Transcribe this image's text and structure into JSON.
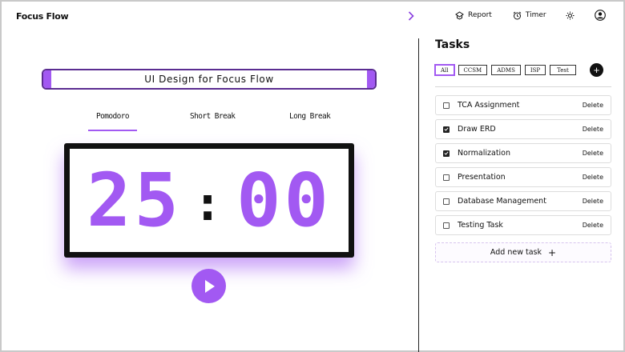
{
  "app": {
    "title": "Focus Flow"
  },
  "nav": {
    "report_label": "Report",
    "timer_label": "Timer"
  },
  "current_task": {
    "value": "UI Design for Focus Flow"
  },
  "modes": [
    {
      "label": "Pomodoro",
      "active": true
    },
    {
      "label": "Short Break",
      "active": false
    },
    {
      "label": "Long Break",
      "active": false
    }
  ],
  "timer": {
    "minutes": "25",
    "separator": ":",
    "seconds": "00"
  },
  "tasks_panel": {
    "heading": "Tasks",
    "filters": [
      {
        "label": "All",
        "active": true
      },
      {
        "label": "CCSM",
        "active": false
      },
      {
        "label": "ADMS",
        "active": false
      },
      {
        "label": "ISP",
        "active": false
      },
      {
        "label": "Test",
        "active": false
      }
    ],
    "add_category_icon": "plus-icon",
    "items": [
      {
        "name": "TCA Assignment",
        "done": false,
        "delete_label": "Delete"
      },
      {
        "name": "Draw ERD",
        "done": true,
        "delete_label": "Delete"
      },
      {
        "name": "Normalization",
        "done": true,
        "delete_label": "Delete"
      },
      {
        "name": "Presentation",
        "done": false,
        "delete_label": "Delete"
      },
      {
        "name": "Database Management",
        "done": false,
        "delete_label": "Delete"
      },
      {
        "name": "Testing Task",
        "done": false,
        "delete_label": "Delete"
      }
    ],
    "add_task_label": "Add new task",
    "add_task_icon": "+"
  },
  "colors": {
    "accent": "#a259f2",
    "accent_dark": "#5b2d91",
    "text": "#111111"
  },
  "icons": [
    "chevron-right-icon",
    "report-icon",
    "alarm-clock-icon",
    "sun-icon",
    "user-avatar-icon",
    "play-icon",
    "plus-icon",
    "check-icon"
  ]
}
